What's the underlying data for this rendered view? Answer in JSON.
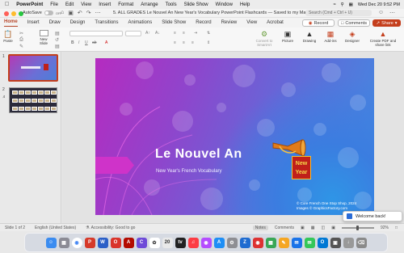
{
  "menubar": {
    "app_name": "PowerPoint",
    "items": [
      "File",
      "Edit",
      "View",
      "Insert",
      "Format",
      "Arrange",
      "Tools",
      "Slide Show",
      "Window",
      "Help"
    ],
    "datetime": "Wed Dec 20  9:52 PM"
  },
  "titlebar": {
    "autosave_label": "AutoSave",
    "autosave_state": "OFF",
    "document_title": "5. ALL GRADES Le Nouvel An New Year's Vocabulary PowerPoint Flashcards — Saved to my Mac",
    "search_placeholder": "Search (Cmd + Ctrl + U)"
  },
  "tabs": [
    "Home",
    "Insert",
    "Draw",
    "Design",
    "Transitions",
    "Animations",
    "Slide Show",
    "Record",
    "Review",
    "View",
    "Acrobat"
  ],
  "active_tab": "Home",
  "actions": {
    "record": "Record",
    "comments": "Comments",
    "share": "Share"
  },
  "ribbon": {
    "paste": "Paste",
    "new_slide": "New Slide",
    "convert_smartart": "Convert to SmartArt",
    "picture": "Picture",
    "drawing": "Drawing",
    "addins": "Add-ins",
    "designer": "Designer",
    "create_pdf": "Create PDF and share link"
  },
  "thumbnails": [
    "1",
    "2"
  ],
  "slide": {
    "title": "Le Nouvel An",
    "subtitle": "New Year's French Vocabulary",
    "badge_line1": "New",
    "badge_line2": "Year",
    "credit_line1": "© Core French One Stop Shop, 2024",
    "credit_line2": "Images © GraphicsFactory.com"
  },
  "status": {
    "slide_info": "Slide 1 of 2",
    "language": "English (United States)",
    "accessibility": "Accessibility: Good to go",
    "notes": "Notes",
    "comments": "Comments",
    "zoom": "92%"
  },
  "notification": {
    "text": "Welcome back!"
  },
  "colors": {
    "accent": "#c43e1c",
    "slide_magenta": "#b52bc0",
    "slide_blue": "#3c8fe2"
  }
}
